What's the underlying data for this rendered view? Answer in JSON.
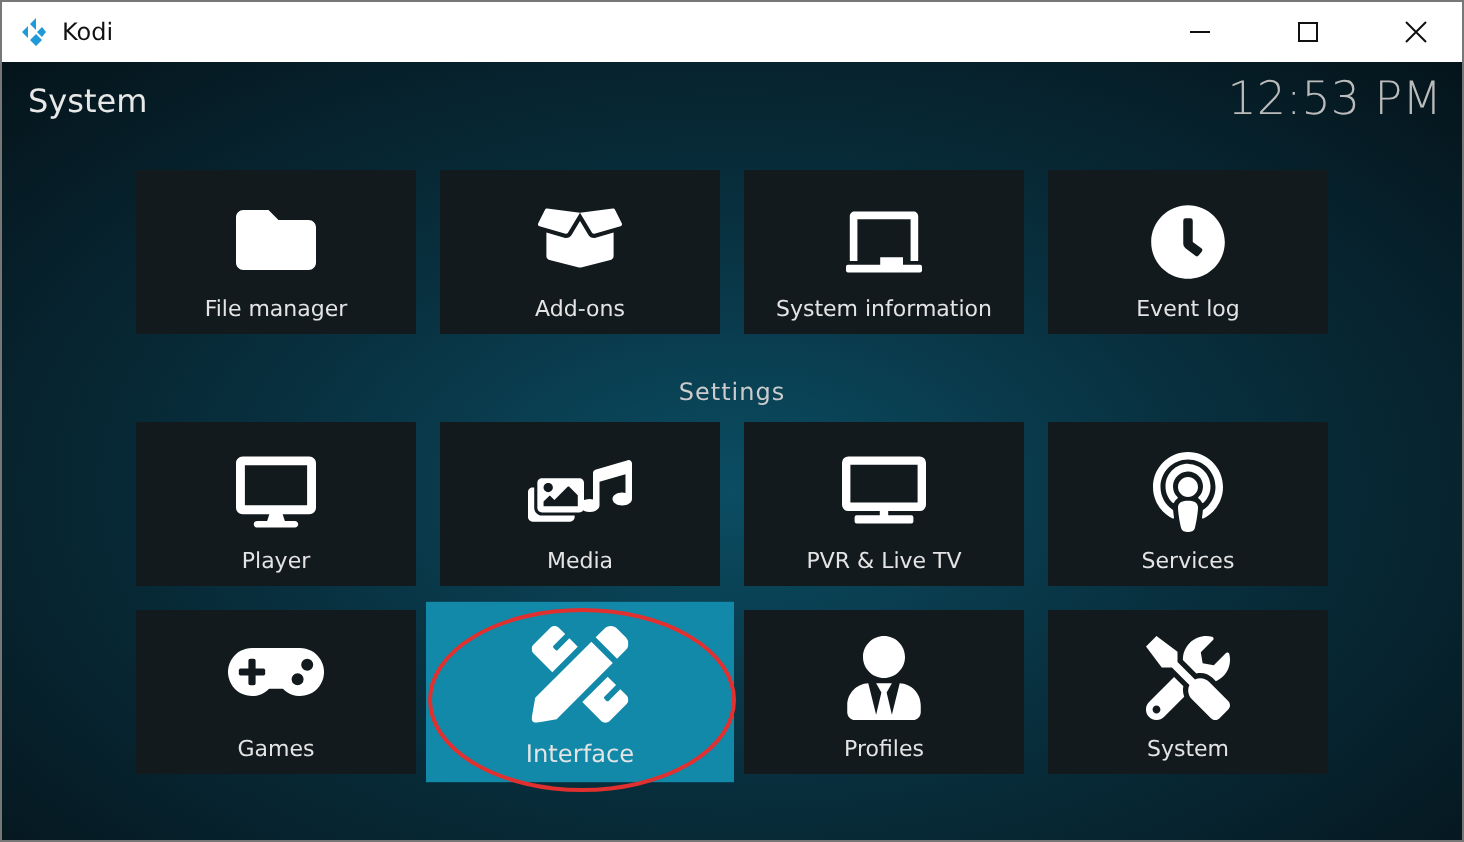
{
  "window": {
    "title": "Kodi"
  },
  "header": {
    "title": "System",
    "clock": "12:53 PM"
  },
  "sections": [
    {
      "tiles": [
        {
          "label": "File manager",
          "selected": false,
          "circled": false
        },
        {
          "label": "Add-ons",
          "selected": false,
          "circled": false
        },
        {
          "label": "System information",
          "selected": false,
          "circled": false
        },
        {
          "label": "Event log",
          "selected": false,
          "circled": false
        }
      ]
    },
    {
      "heading": "Settings",
      "tiles": [
        {
          "label": "Player",
          "selected": false,
          "circled": false
        },
        {
          "label": "Media",
          "selected": false,
          "circled": false
        },
        {
          "label": "PVR & Live TV",
          "selected": false,
          "circled": false
        },
        {
          "label": "Services",
          "selected": false,
          "circled": false
        },
        {
          "label": "Games",
          "selected": false,
          "circled": false
        },
        {
          "label": "Interface",
          "selected": true,
          "circled": true
        },
        {
          "label": "Profiles",
          "selected": false,
          "circled": false
        },
        {
          "label": "System",
          "selected": false,
          "circled": false
        }
      ]
    }
  ]
}
